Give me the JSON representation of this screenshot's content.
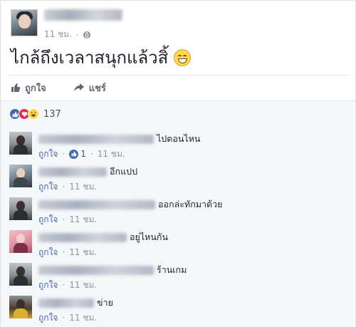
{
  "post": {
    "time": "11 ชม.",
    "privacy_icon": "globe-icon",
    "text": "ไกล้ถึงเวลาสนุกแล้วสิ้",
    "emoji": "grinning-face-emoji"
  },
  "actions": {
    "like_label": "ถูกใจ",
    "share_label": "แชร์"
  },
  "reactions": {
    "types": [
      "like",
      "love",
      "haha"
    ],
    "count": "137"
  },
  "comments": [
    {
      "text": "ไปตอนไหน",
      "like_label": "ถูกใจ",
      "likes": "1",
      "time": "11 ชม."
    },
    {
      "text": "อีกแปป",
      "like_label": "ถูกใจ",
      "time": "11 ชม."
    },
    {
      "text": "ออกล่ะทักมาด้วย",
      "like_label": "ถูกใจ",
      "time": "11 ชม."
    },
    {
      "text": "อยู่ไหนกัน",
      "like_label": "ถูกใจ",
      "time": "11 ชม."
    },
    {
      "text": "ร้านเกม",
      "like_label": "ถูกใจ",
      "time": "11 ชม."
    },
    {
      "text": "ข่าย",
      "like_label": "ถูกใจ",
      "time": "11 ชม."
    }
  ],
  "colors": {
    "link": "#4267b2",
    "meta": "#90949c",
    "like": "#4267b2",
    "love": "#f0284a",
    "haha": "#ffd84f"
  }
}
